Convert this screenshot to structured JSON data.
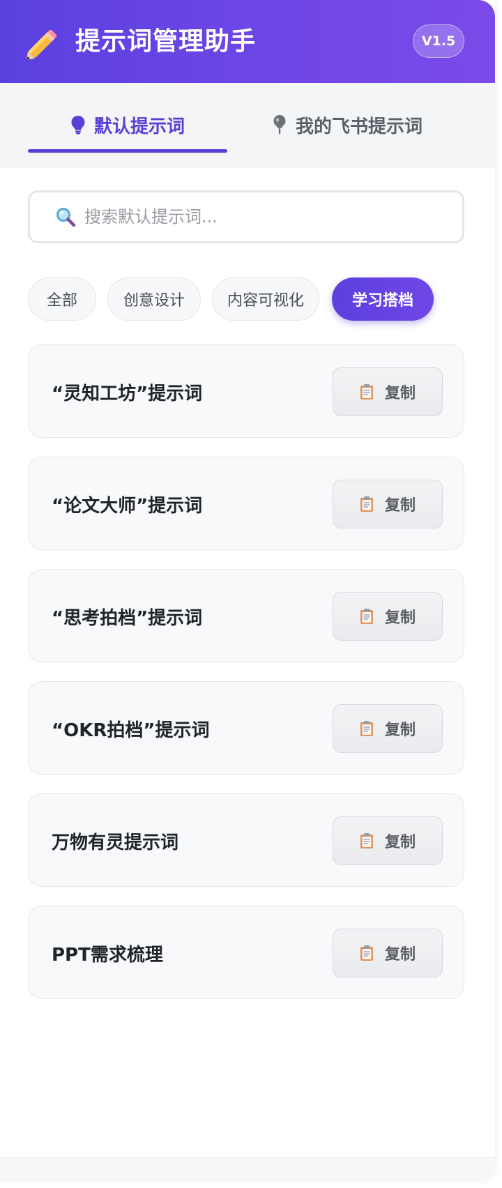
{
  "header": {
    "title": "提示词管理助手",
    "version": "V1.5"
  },
  "tabs": [
    {
      "label": "默认提示词",
      "icon": "lightbulb-icon",
      "active": true
    },
    {
      "label": "我的飞书提示词",
      "icon": "pin-icon",
      "active": false
    }
  ],
  "search": {
    "placeholder": "搜索默认提示词...",
    "value": ""
  },
  "filters": [
    {
      "label": "全部",
      "active": false
    },
    {
      "label": "创意设计",
      "active": false
    },
    {
      "label": "内容可视化",
      "active": false
    },
    {
      "label": "学习搭档",
      "active": true
    }
  ],
  "prompts": [
    {
      "title": "“灵知工坊”提示词",
      "copy_label": "复制"
    },
    {
      "title": "“论文大师”提示词",
      "copy_label": "复制"
    },
    {
      "title": "“思考拍档”提示词",
      "copy_label": "复制"
    },
    {
      "title": "“OKR拍档”提示词",
      "copy_label": "复制"
    },
    {
      "title": "万物有灵提示词",
      "copy_label": "复制"
    },
    {
      "title": "PPT需求梳理",
      "copy_label": "复制"
    }
  ],
  "colors": {
    "accent": "#5a3fd6",
    "header_gradient_start": "#5b3fdf",
    "header_gradient_end": "#7a4ae8"
  }
}
